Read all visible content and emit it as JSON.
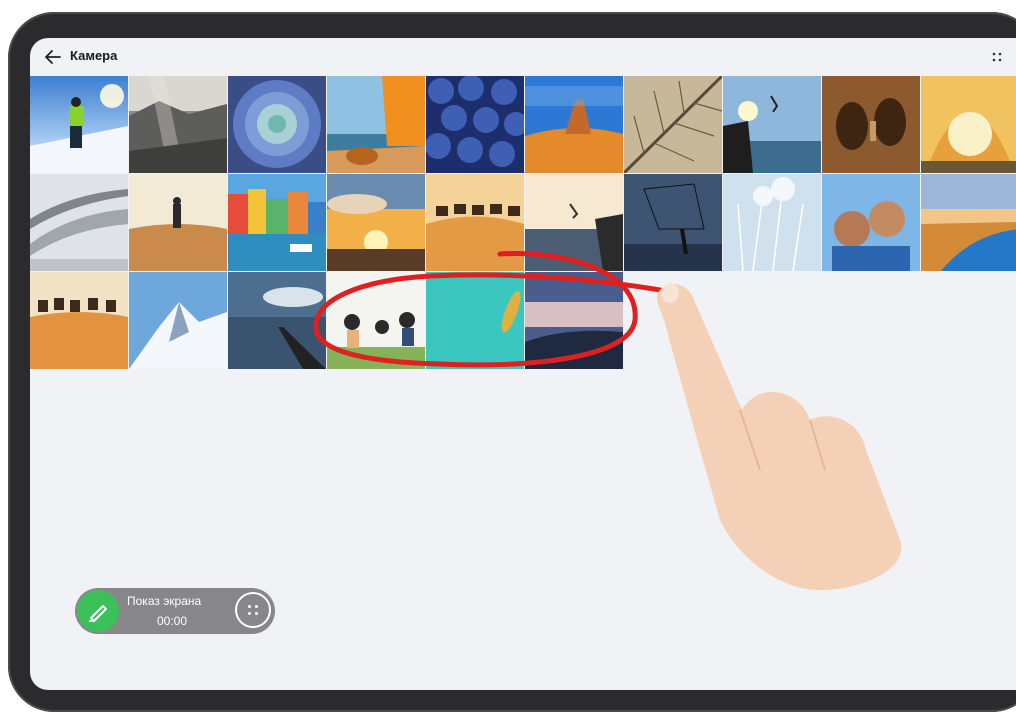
{
  "app": {
    "title": "Камера"
  },
  "recorder": {
    "label": "Показ экрана",
    "time": "00:00"
  },
  "colors": {
    "annotation": "#e02020",
    "recorder_button": "#3cc15a"
  },
  "icons": {
    "back": "arrow-left-icon",
    "more": "more-dots-icon",
    "pen": "pen-icon",
    "recorder_more": "dots-grid-icon"
  },
  "gallery": {
    "rows": [
      [
        "skier",
        "sunrays-mountains",
        "succulent",
        "tent-beach",
        "blueberries",
        "desert-rock",
        "leaf-veins",
        "cliff-jump",
        "shadow-wall",
        "tent-sunset"
      ],
      [
        "curved-architecture",
        "desert-hiker",
        "colorful-harbor",
        "sunset-clouds",
        "camel-caravan",
        "sea-diver",
        "fisherman-net",
        "dandelion",
        "family-selfie",
        "lake-horizon"
      ],
      [
        "camels-dunes",
        "snowy-peak",
        "sea-pier",
        "picnic-friends",
        "turquoise-sea-boat",
        "coast-dusk"
      ]
    ]
  }
}
